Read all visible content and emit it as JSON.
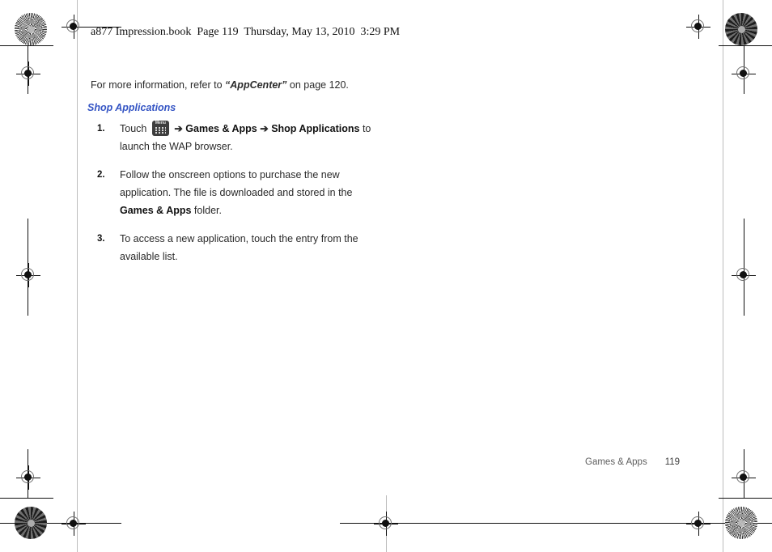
{
  "document": {
    "header_line": "a877 Impression.book  Page 119  Thursday, May 13, 2010  3:29 PM",
    "intro": {
      "before": "For more information, refer to ",
      "quoted": "“AppCenter”",
      "after": "  on page 120."
    },
    "section_heading": "Shop Applications",
    "steps": [
      {
        "number": "1.",
        "prefix": "Touch ",
        "icon_label": "Menu",
        "arrow1": "➔",
        "target1": "Games & Apps",
        "arrow2": "➔",
        "target2": "Shop Applications",
        "suffix": " to launch the WAP browser."
      },
      {
        "number": "2.",
        "text_before": "Follow the onscreen options to purchase the new application. The file is downloaded and stored in the ",
        "bold": "Games & Apps",
        "text_after": " folder."
      },
      {
        "number": "3.",
        "text": "To access a new application, touch the entry from the available list."
      }
    ],
    "footer": {
      "chapter": "Games & Apps",
      "page_number": "119"
    }
  },
  "print_marks": {
    "registration_icon": "registration-target",
    "rosette_icon": "print-rosette",
    "heading_color": "#3454c4"
  }
}
